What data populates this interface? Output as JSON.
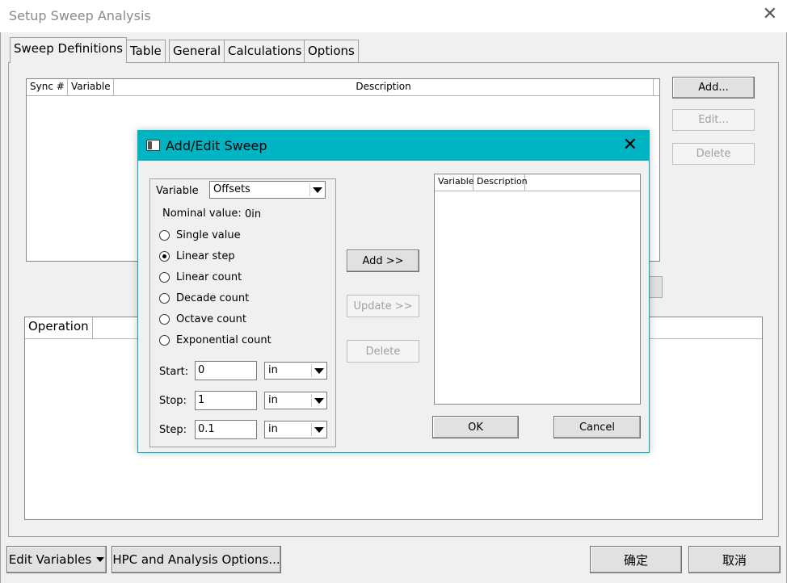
{
  "window": {
    "title": "Setup Sweep Analysis"
  },
  "tabs": [
    {
      "label": "Sweep Definitions"
    },
    {
      "label": "Table"
    },
    {
      "label": "General"
    },
    {
      "label": "Calculations"
    },
    {
      "label": "Options"
    }
  ],
  "sweep_list": {
    "columns": [
      "Sync #",
      "Variable",
      "Description"
    ]
  },
  "side_buttons": {
    "add": "Add...",
    "edit": "Edit...",
    "delete": "Delete"
  },
  "operation_list": {
    "columns": [
      "Operation"
    ]
  },
  "bottom": {
    "edit_variables": "Edit Variables",
    "hpc_options": "HPC and Analysis Options...",
    "ok": "确定",
    "cancel": "取消"
  },
  "dialog": {
    "title": "Add/Edit Sweep",
    "variable_label": "Variable",
    "variable_value": "Offsets",
    "nominal_label": "Nominal value:",
    "nominal_value": "0in",
    "options": [
      {
        "label": "Single value",
        "checked": false
      },
      {
        "label": "Linear step",
        "checked": true
      },
      {
        "label": "Linear count",
        "checked": false
      },
      {
        "label": "Decade count",
        "checked": false
      },
      {
        "label": "Octave count",
        "checked": false
      },
      {
        "label": "Exponential count",
        "checked": false
      }
    ],
    "start_label": "Start:",
    "start_value": "0",
    "start_unit": "in",
    "stop_label": "Stop:",
    "stop_value": "1",
    "stop_unit": "in",
    "step_label": "Step:",
    "step_value": "0.1",
    "step_unit": "in",
    "add_button": "Add >>",
    "update_button": "Update >>",
    "delete_button": "Delete",
    "right_columns": [
      "Variable",
      "Description"
    ],
    "ok_button": "OK",
    "cancel_button": "Cancel"
  }
}
